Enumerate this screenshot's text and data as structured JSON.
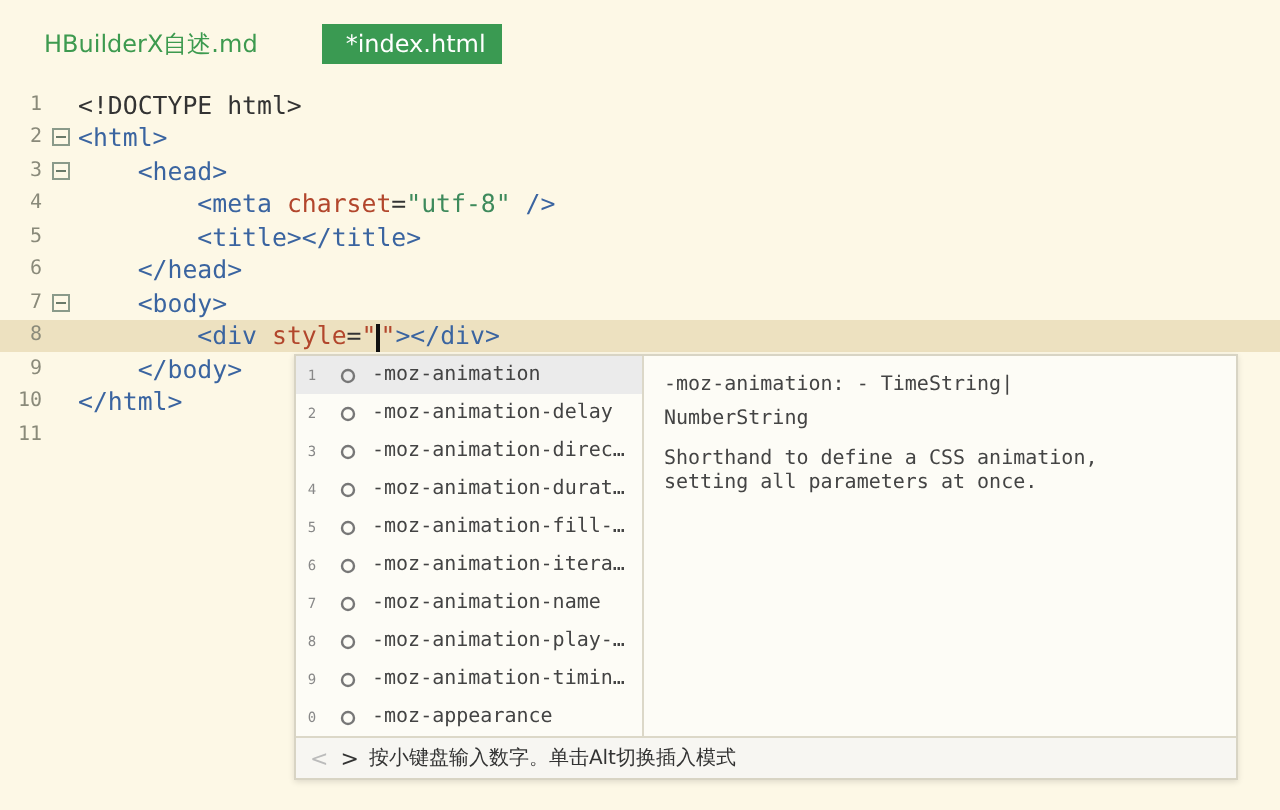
{
  "tabs": [
    {
      "label": "HBuilderX自述.md",
      "selected": false
    },
    {
      "label": "*index.html",
      "selected": true
    }
  ],
  "editor": {
    "lines": [
      {
        "number": "1",
        "current": false,
        "tokens": [
          {
            "kind": "plain",
            "text": "<!DOCTYPE html>"
          }
        ]
      },
      {
        "number": "2",
        "fold": true,
        "current": false,
        "tokens": [
          {
            "kind": "tag",
            "text": "<html>"
          }
        ]
      },
      {
        "number": "3",
        "fold": true,
        "current": false,
        "tokens": [
          {
            "kind": "tag",
            "text": "    <head>"
          }
        ]
      },
      {
        "number": "4",
        "current": false,
        "tokens": [
          {
            "kind": "tag",
            "text": "        <meta "
          },
          {
            "kind": "attr",
            "text": "charset"
          },
          {
            "kind": "plain",
            "text": "="
          },
          {
            "kind": "value",
            "text": "\"utf-8\""
          },
          {
            "kind": "tag",
            "text": " />"
          }
        ]
      },
      {
        "number": "5",
        "current": false,
        "tokens": [
          {
            "kind": "tag",
            "text": "        <title></title>"
          }
        ]
      },
      {
        "number": "6",
        "current": false,
        "tokens": [
          {
            "kind": "tag",
            "text": "    </head>"
          }
        ]
      },
      {
        "number": "7",
        "fold": true,
        "current": false,
        "tokens": [
          {
            "kind": "tag",
            "text": "    <body>"
          }
        ]
      },
      {
        "number": "8",
        "current": true,
        "tokens": [
          {
            "kind": "tag",
            "text": "        <div "
          },
          {
            "kind": "attr",
            "text": "style"
          },
          {
            "kind": "plain",
            "text": "="
          },
          {
            "kind": "attr",
            "text": "\""
          },
          {
            "kind": "caret"
          },
          {
            "kind": "attr",
            "text": "\""
          },
          {
            "kind": "tag",
            "text": "></div>"
          }
        ]
      },
      {
        "number": "9",
        "current": false,
        "tokens": [
          {
            "kind": "tag",
            "text": "    </body>"
          }
        ]
      },
      {
        "number": "10",
        "current": false,
        "tokens": [
          {
            "kind": "tag",
            "text": "</html>"
          }
        ]
      },
      {
        "number": "11",
        "current": false
      }
    ]
  },
  "autocomplete": {
    "items": [
      {
        "index": "1",
        "label": "-moz-animation",
        "selected": true
      },
      {
        "index": "2",
        "label": "-moz-animation-delay",
        "selected": false
      },
      {
        "index": "3",
        "label": "-moz-animation-direc…",
        "selected": false
      },
      {
        "index": "4",
        "label": "-moz-animation-durat…",
        "selected": false
      },
      {
        "index": "5",
        "label": "-moz-animation-fill-…",
        "selected": false
      },
      {
        "index": "6",
        "label": "-moz-animation-itera…",
        "selected": false
      },
      {
        "index": "7",
        "label": "-moz-animation-name",
        "selected": false
      },
      {
        "index": "8",
        "label": "-moz-animation-play-…",
        "selected": false
      },
      {
        "index": "9",
        "label": "-moz-animation-timin…",
        "selected": false
      },
      {
        "index": "0",
        "label": "-moz-appearance",
        "selected": false
      }
    ],
    "detail": {
      "signature": [
        "-moz-animation: - TimeString|",
        "NumberString"
      ],
      "description": "Shorthand to define a CSS animation, setting all parameters at once."
    },
    "footer": {
      "nav": [
        {
          "label": "<",
          "disabled": true
        },
        {
          "label": ">",
          "disabled": false
        }
      ],
      "hint": "按小键盘输入数字。单击Alt切换插入模式"
    }
  }
}
